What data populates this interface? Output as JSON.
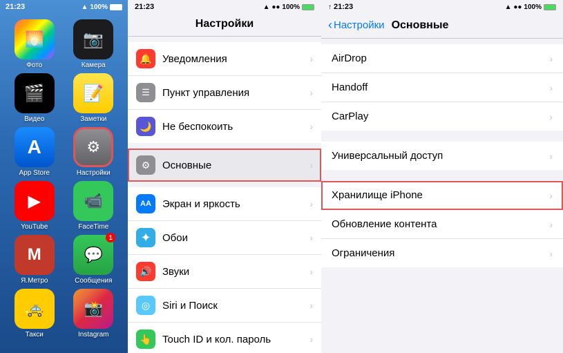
{
  "home_screen": {
    "status_bar": {
      "time": "21:23",
      "signal": "●●●",
      "battery": "100%"
    },
    "apps": [
      {
        "id": "photos",
        "label": "Фото",
        "icon": "🌅",
        "bg": "bg-photos",
        "badge": null
      },
      {
        "id": "camera",
        "label": "Камера",
        "icon": "📷",
        "bg": "bg-camera",
        "badge": null
      },
      {
        "id": "video",
        "label": "Видео",
        "icon": "🎬",
        "bg": "bg-video",
        "badge": null
      },
      {
        "id": "notes",
        "label": "Заметки",
        "icon": "📝",
        "bg": "bg-notes",
        "badge": null
      },
      {
        "id": "appstore",
        "label": "App Store",
        "icon": "A",
        "bg": "bg-appstore",
        "badge": null
      },
      {
        "id": "settings",
        "label": "Настройки",
        "icon": "⚙",
        "bg": "bg-settings",
        "badge": null,
        "selected": true
      },
      {
        "id": "youtube",
        "label": "YouTube",
        "icon": "▶",
        "bg": "bg-youtube",
        "badge": null
      },
      {
        "id": "facetime",
        "label": "FaceTime",
        "icon": "📹",
        "bg": "bg-facetime",
        "badge": null
      },
      {
        "id": "metro",
        "label": "Я.Метро",
        "icon": "М",
        "bg": "bg-metro",
        "badge": null
      },
      {
        "id": "messages",
        "label": "Сообщения",
        "icon": "💬",
        "bg": "bg-messages",
        "badge": "1"
      },
      {
        "id": "taxi",
        "label": "Такси",
        "icon": "🚕",
        "bg": "bg-taxi",
        "badge": null
      },
      {
        "id": "instagram",
        "label": "Instagram",
        "icon": "📸",
        "bg": "bg-instagram",
        "badge": null
      }
    ]
  },
  "settings_panel": {
    "status_bar": {
      "time": "21:23",
      "battery": "100%"
    },
    "title": "Настройки",
    "rows": [
      {
        "id": "notifications",
        "label": "Уведомления",
        "icon": "🔴",
        "icon_bg": "ic-red"
      },
      {
        "id": "control",
        "label": "Пункт управления",
        "icon": "☰",
        "icon_bg": "ic-gray"
      },
      {
        "id": "dnd",
        "label": "Не беспокоить",
        "icon": "🌙",
        "icon_bg": "ic-purple"
      },
      {
        "id": "general",
        "label": "Основные",
        "icon": "⚙",
        "icon_bg": "ic-settings",
        "selected": true
      },
      {
        "id": "display",
        "label": "Экран и яркость",
        "icon": "AA",
        "icon_bg": "ic-blue"
      },
      {
        "id": "wallpaper",
        "label": "Обои",
        "icon": "✦",
        "icon_bg": "ic-teal"
      },
      {
        "id": "sounds",
        "label": "Звуки",
        "icon": "🔊",
        "icon_bg": "ic-red"
      },
      {
        "id": "siri",
        "label": "Siri и Поиск",
        "icon": "◎",
        "icon_bg": "ic-indigo"
      },
      {
        "id": "touchid",
        "label": "Touch ID и кол. пароль",
        "icon": "👆",
        "icon_bg": "ic-green"
      }
    ]
  },
  "general_panel": {
    "status_bar": {
      "time": "21:23",
      "battery": "100%"
    },
    "back_label": "Настройки",
    "title": "Основные",
    "rows": [
      {
        "id": "airdrop",
        "label": "AirDrop"
      },
      {
        "id": "handoff",
        "label": "Handoff"
      },
      {
        "id": "carplay",
        "label": "CarPlay"
      },
      {
        "id": "accessibility",
        "label": "Универсальный доступ"
      },
      {
        "id": "storage",
        "label": "Хранилище iPhone",
        "highlighted": true
      },
      {
        "id": "content_update",
        "label": "Обновление контента"
      },
      {
        "id": "restrictions",
        "label": "Ограничения"
      }
    ]
  }
}
